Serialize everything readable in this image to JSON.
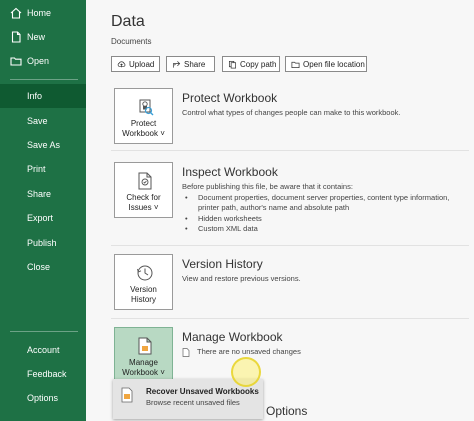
{
  "sidebar": {
    "top_items": [
      {
        "label": "Home",
        "icon": "home-icon"
      },
      {
        "label": "New",
        "icon": "new-document-icon"
      },
      {
        "label": "Open",
        "icon": "folder-icon"
      }
    ],
    "middle_items": [
      "Info",
      "Save",
      "Save As",
      "Print",
      "Share",
      "Export",
      "Publish",
      "Close"
    ],
    "bottom_items": [
      "Account",
      "Feedback",
      "Options"
    ],
    "active_item": "Info"
  },
  "main": {
    "title": "Data",
    "subtitle": "Documents",
    "buttons": [
      {
        "label": "Upload",
        "icon": "upload-icon"
      },
      {
        "label": "Share",
        "icon": "share-icon"
      },
      {
        "label": "Copy path",
        "icon": "copy-icon"
      },
      {
        "label": "Open file location",
        "icon": "folder-icon"
      }
    ],
    "sections": {
      "protect": {
        "tile_label": "Protect Workbook ˅",
        "title": "Protect Workbook",
        "description": "Control what types of changes people can make to this workbook."
      },
      "inspect": {
        "tile_label": "Check for Issues ˅",
        "title": "Inspect Workbook",
        "description": "Before publishing this file, be aware that it contains:",
        "bullets": [
          "Document properties, document server properties, content type information, printer path, author's name and absolute path",
          "Hidden worksheets",
          "Custom XML data"
        ]
      },
      "version": {
        "tile_label": "Version History",
        "title": "Version History",
        "description": "View and restore previous versions."
      },
      "manage": {
        "tile_label": "Manage Workbook ˅",
        "title": "Manage Workbook",
        "status": "There are no unsaved changes"
      }
    },
    "dropdown": {
      "title": "Recover Unsaved Workbooks",
      "description": "Browse recent unsaved files"
    },
    "partial_section_title": "Options"
  },
  "colors": {
    "sidebar_bg": "#1e7145",
    "sidebar_active": "#0f5a31",
    "tile_selected": "#b8d9c3",
    "main_bg": "#f7f7f7"
  }
}
